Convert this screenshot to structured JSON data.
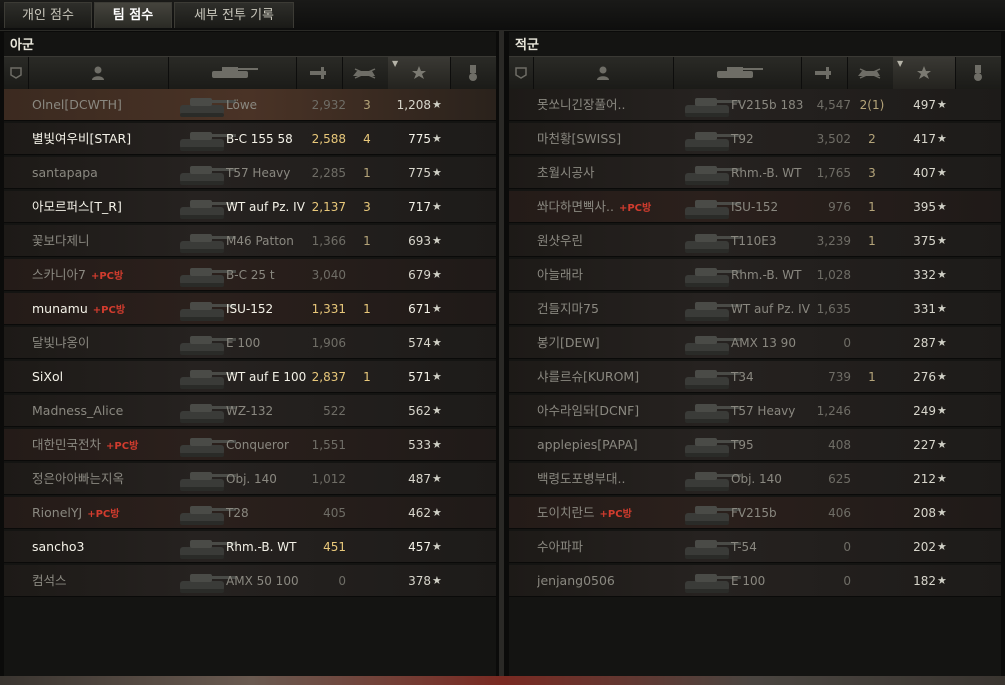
{
  "tabs": [
    {
      "label": "개인 점수",
      "active": false
    },
    {
      "label": "팀 점수",
      "active": true
    },
    {
      "label": "세부 전투 기록",
      "active": false
    }
  ],
  "allies": {
    "title": "아군",
    "rows": [
      {
        "name": "Olnel[DCWTH]",
        "pc": "",
        "vehicle": "Löwe",
        "damage": "2,932",
        "kills": "3",
        "score": "1,208",
        "alive": false,
        "highlight": true
      },
      {
        "name": "별빛여우비[STAR]",
        "pc": "",
        "vehicle": "B-C 155 58",
        "damage": "2,588",
        "kills": "4",
        "score": "775",
        "alive": true
      },
      {
        "name": "santapapa",
        "pc": "",
        "vehicle": "T57 Heavy",
        "damage": "2,285",
        "kills": "1",
        "score": "775",
        "alive": false
      },
      {
        "name": "아모르퍼스[T_R]",
        "pc": "",
        "vehicle": "WT auf Pz. IV",
        "damage": "2,137",
        "kills": "3",
        "score": "717",
        "alive": true
      },
      {
        "name": "꽃보다제니",
        "pc": "",
        "vehicle": "M46 Patton",
        "damage": "1,366",
        "kills": "1",
        "score": "693",
        "alive": false
      },
      {
        "name": "스카니아7",
        "pc": "+PC방",
        "vehicle": "B-C 25 t",
        "damage": "3,040",
        "kills": "",
        "score": "679",
        "alive": false
      },
      {
        "name": "munamu",
        "pc": "+PC방",
        "vehicle": "ISU-152",
        "damage": "1,331",
        "kills": "1",
        "score": "671",
        "alive": true
      },
      {
        "name": "달빛냐옹이",
        "pc": "",
        "vehicle": "E 100",
        "damage": "1,906",
        "kills": "",
        "score": "574",
        "alive": false
      },
      {
        "name": "SiXol",
        "pc": "",
        "vehicle": "WT auf E 100",
        "damage": "2,837",
        "kills": "1",
        "score": "571",
        "alive": true
      },
      {
        "name": "Madness_Alice",
        "pc": "",
        "vehicle": "WZ-132",
        "damage": "522",
        "kills": "",
        "score": "562",
        "alive": false
      },
      {
        "name": "대한민국전차",
        "pc": "+PC방",
        "vehicle": "Conqueror",
        "damage": "1,551",
        "kills": "",
        "score": "533",
        "alive": false
      },
      {
        "name": "정은아아빠는지옥",
        "pc": "",
        "vehicle": "Obj. 140",
        "damage": "1,012",
        "kills": "",
        "score": "487",
        "alive": false
      },
      {
        "name": "RionelYJ",
        "pc": "+PC방",
        "vehicle": "T28",
        "damage": "405",
        "kills": "",
        "score": "462",
        "alive": false
      },
      {
        "name": "sancho3",
        "pc": "",
        "vehicle": "Rhm.-B. WT",
        "damage": "451",
        "kills": "",
        "score": "457",
        "alive": true
      },
      {
        "name": "컴석스",
        "pc": "",
        "vehicle": "AMX 50 100",
        "damage": "0",
        "kills": "",
        "score": "378",
        "alive": false
      }
    ]
  },
  "enemies": {
    "title": "적군",
    "rows": [
      {
        "name": "못쏘니긴장풀어..",
        "pc": "",
        "vehicle": "FV215b 183",
        "damage": "4,547",
        "kills": "2(1)",
        "score": "497",
        "alive": false
      },
      {
        "name": "마천황[SWISS]",
        "pc": "",
        "vehicle": "T92",
        "damage": "3,502",
        "kills": "2",
        "score": "417",
        "alive": false
      },
      {
        "name": "초월시공사",
        "pc": "",
        "vehicle": "Rhm.-B. WT",
        "damage": "1,765",
        "kills": "3",
        "score": "407",
        "alive": false
      },
      {
        "name": "쏴다하면삑사..",
        "pc": "+PC방",
        "vehicle": "ISU-152",
        "damage": "976",
        "kills": "1",
        "score": "395",
        "alive": false
      },
      {
        "name": "원샷우린",
        "pc": "",
        "vehicle": "T110E3",
        "damage": "3,239",
        "kills": "1",
        "score": "375",
        "alive": false
      },
      {
        "name": "아늘래라",
        "pc": "",
        "vehicle": "Rhm.-B. WT",
        "damage": "1,028",
        "kills": "",
        "score": "332",
        "alive": false
      },
      {
        "name": "건들지마75",
        "pc": "",
        "vehicle": "WT auf Pz. IV",
        "damage": "1,635",
        "kills": "",
        "score": "331",
        "alive": false
      },
      {
        "name": "봉기[DEW]",
        "pc": "",
        "vehicle": "AMX 13 90",
        "damage": "0",
        "kills": "",
        "score": "287",
        "alive": false
      },
      {
        "name": "샤를르슈[KUROM]",
        "pc": "",
        "vehicle": "T34",
        "damage": "739",
        "kills": "1",
        "score": "276",
        "alive": false
      },
      {
        "name": "아수라임돠[DCNF]",
        "pc": "",
        "vehicle": "T57 Heavy",
        "damage": "1,246",
        "kills": "",
        "score": "249",
        "alive": false
      },
      {
        "name": "applepies[PAPA]",
        "pc": "",
        "vehicle": "T95",
        "damage": "408",
        "kills": "",
        "score": "227",
        "alive": false
      },
      {
        "name": "백령도포병부대..",
        "pc": "",
        "vehicle": "Obj. 140",
        "damage": "625",
        "kills": "",
        "score": "212",
        "alive": false
      },
      {
        "name": "도이치란드",
        "pc": "+PC방",
        "vehicle": "FV215b",
        "damage": "406",
        "kills": "",
        "score": "208",
        "alive": false
      },
      {
        "name": "수아파파",
        "pc": "",
        "vehicle": "T-54",
        "damage": "0",
        "kills": "",
        "score": "202",
        "alive": false
      },
      {
        "name": "jenjang0506",
        "pc": "",
        "vehicle": "E 100",
        "damage": "0",
        "kills": "",
        "score": "182",
        "alive": false
      }
    ]
  },
  "icons": {
    "star": "★"
  }
}
